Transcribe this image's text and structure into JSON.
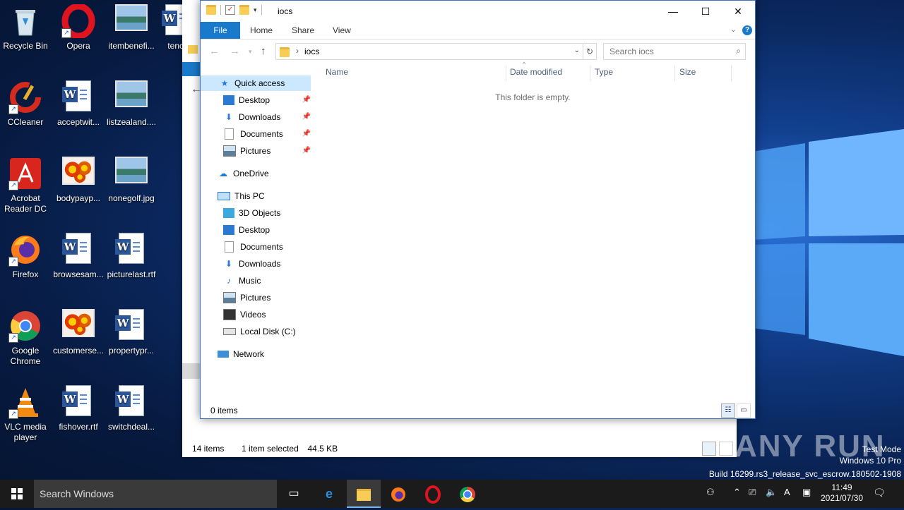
{
  "desktop": {
    "icons": [
      {
        "label": "Recycle Bin"
      },
      {
        "label": "Opera"
      },
      {
        "label": "itembenefi..."
      },
      {
        "label": "tench"
      },
      {
        "label": "CCleaner"
      },
      {
        "label": "acceptwit..."
      },
      {
        "label": "listzealand...."
      },
      {
        "label": "Acrobat Reader DC"
      },
      {
        "label": "bodypayp..."
      },
      {
        "label": "nonegolf.jpg"
      },
      {
        "label": "Firefox"
      },
      {
        "label": "browsesam..."
      },
      {
        "label": "picturelast.rtf"
      },
      {
        "label": "Google Chrome"
      },
      {
        "label": "customerse..."
      },
      {
        "label": "propertypr..."
      },
      {
        "label": "VLC media player"
      },
      {
        "label": "fishover.rtf"
      },
      {
        "label": "switchdeal..."
      }
    ]
  },
  "background_window": {
    "status_items": "14 items",
    "status_selected": "1 item selected",
    "status_size": "44.5 KB"
  },
  "explorer": {
    "title": "iocs",
    "controls": {
      "minimize": "—",
      "maximize": "☐",
      "close": "✕"
    },
    "ribbon": {
      "file": "File",
      "home": "Home",
      "share": "Share",
      "view": "View"
    },
    "address": {
      "crumb": "iocs"
    },
    "search": {
      "placeholder": "Search iocs"
    },
    "nav": {
      "quick_access": "Quick access",
      "qa_items": [
        "Desktop",
        "Downloads",
        "Documents",
        "Pictures"
      ],
      "onedrive": "OneDrive",
      "this_pc": "This PC",
      "pc_items": [
        "3D Objects",
        "Desktop",
        "Documents",
        "Downloads",
        "Music",
        "Pictures",
        "Videos",
        "Local Disk (C:)"
      ],
      "network": "Network"
    },
    "columns": {
      "name": "Name",
      "date": "Date modified",
      "type": "Type",
      "size": "Size"
    },
    "empty_message": "This folder is empty.",
    "status": "0 items"
  },
  "taskbar": {
    "search_placeholder": "Search Windows",
    "time": "11:49",
    "date": "2021/07/30"
  },
  "watermark": {
    "line1": "Test Mode",
    "line2": "Windows 10 Pro",
    "line3": "Build 16299.rs3_release_svc_escrow.180502-1908",
    "logo": "ANY RUN"
  }
}
